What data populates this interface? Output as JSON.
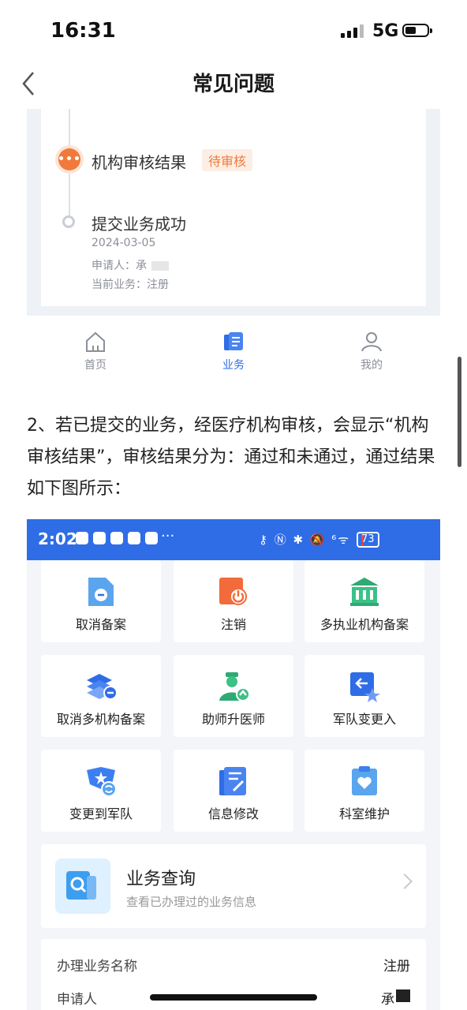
{
  "status_bar": {
    "time": "16:31",
    "network": "5G"
  },
  "header": {
    "title": "常见问题",
    "back_icon": "chevron-left-icon"
  },
  "timeline": {
    "step1": {
      "title": "机构审核结果",
      "badge": "待审核",
      "badge_color": "#f07a3c"
    },
    "step2": {
      "title": "提交业务成功",
      "date": "2024-03-05",
      "applicant_label": "申请人：",
      "applicant_value": "承",
      "business_label": "当前业务：",
      "business_value": "注册"
    }
  },
  "tabbar": {
    "tabs": [
      {
        "label": "首页",
        "icon": "home-icon"
      },
      {
        "label": "业务",
        "icon": "business-icon",
        "active": true
      },
      {
        "label": "我的",
        "icon": "user-icon"
      }
    ],
    "active_color": "#2f6de6"
  },
  "paragraph": "2、若已提交的业务，经医疗机构审核，会显示“机构审核结果”，审核结果分为：通过和未通过，通过结果如下图所示：",
  "shot2": {
    "time": "2:02",
    "dots": "···",
    "right_icons": "⚷ Ⓝ ✱ 🔕 ⁶ᯤ ❗",
    "battery": "73",
    "grid": [
      {
        "label": "取消备案",
        "icon": "cancel-filing-icon"
      },
      {
        "label": "注销",
        "icon": "deregister-icon"
      },
      {
        "label": "多执业机构备案",
        "icon": "institution-icon"
      },
      {
        "label": "取消多机构备案",
        "icon": "cancel-multi-icon"
      },
      {
        "label": "助师升医师",
        "icon": "doctor-upgrade-icon"
      },
      {
        "label": "军队变更入",
        "icon": "military-in-icon"
      },
      {
        "label": "变更到军队",
        "icon": "to-military-icon"
      },
      {
        "label": "信息修改",
        "icon": "edit-info-icon"
      },
      {
        "label": "科室维护",
        "icon": "department-icon"
      }
    ],
    "query": {
      "title": "业务查询",
      "subtitle": "查看已办理过的业务信息"
    },
    "info": [
      {
        "label": "办理业务名称",
        "value": "注册"
      },
      {
        "label": "申请人",
        "value": "承"
      }
    ]
  }
}
